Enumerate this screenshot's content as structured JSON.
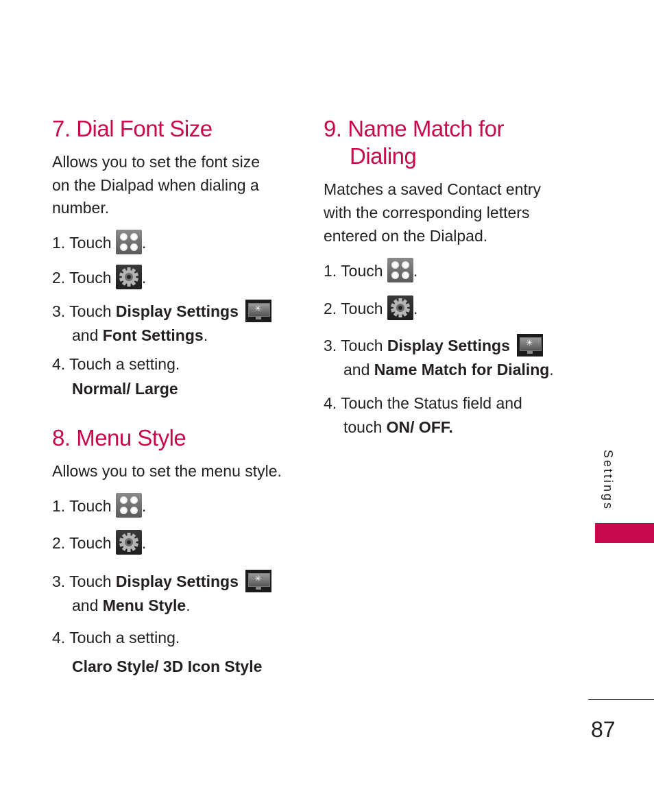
{
  "sections": [
    {
      "heading_number": "7.",
      "heading_text": "Dial Font Size",
      "description": [
        "Allows you to set the font size",
        "on the Dialpad when dialing a",
        "number."
      ],
      "steps": {
        "s1_prefix": "1. Touch",
        "s1_icon": "apps-grid-icon",
        "s2_prefix": "2. Touch",
        "s2_icon": "gear-settings-icon",
        "s3_prefix": "3. Touch",
        "s3_bold1": "Display Settings",
        "s3_icon": "display-settings-icon",
        "s3_and": "and",
        "s3_bold2": "Font Settings",
        "s4_text": "4. Touch a setting.",
        "s4_options": "Normal/ Large"
      }
    },
    {
      "heading_number": "8.",
      "heading_text": "Menu Style",
      "description": [
        "Allows you to set the menu style."
      ],
      "steps": {
        "s1_prefix": "1. Touch",
        "s2_prefix": "2. Touch",
        "s3_prefix": "3. Touch",
        "s3_bold1": "Display Settings",
        "s3_and": "and",
        "s3_bold2": "Menu Style",
        "s4_text": "4. Touch a setting.",
        "s4_options": "Claro Style/ 3D Icon Style"
      }
    },
    {
      "heading_number": "9.",
      "heading_text_line1": "Name Match for",
      "heading_text_line2": "Dialing",
      "description": [
        "Matches a saved Contact entry",
        "with the corresponding letters",
        "entered on the Dialpad."
      ],
      "steps": {
        "s1_prefix": "1. Touch",
        "s2_prefix": "2. Touch",
        "s3_prefix": "3. Touch",
        "s3_bold1": "Display Settings",
        "s3_and": "and",
        "s3_bold2": "Name Match for Dialing",
        "s4_line1": "4. Touch the Status field and",
        "s4_line2_prefix": "touch",
        "s4_line2_bold": "ON/ OFF."
      }
    }
  ],
  "punct": {
    "period": "."
  },
  "side_tab": {
    "label": "Settings",
    "color": "#c8094c"
  },
  "page_number": "87",
  "accent_color": "#c8094c"
}
